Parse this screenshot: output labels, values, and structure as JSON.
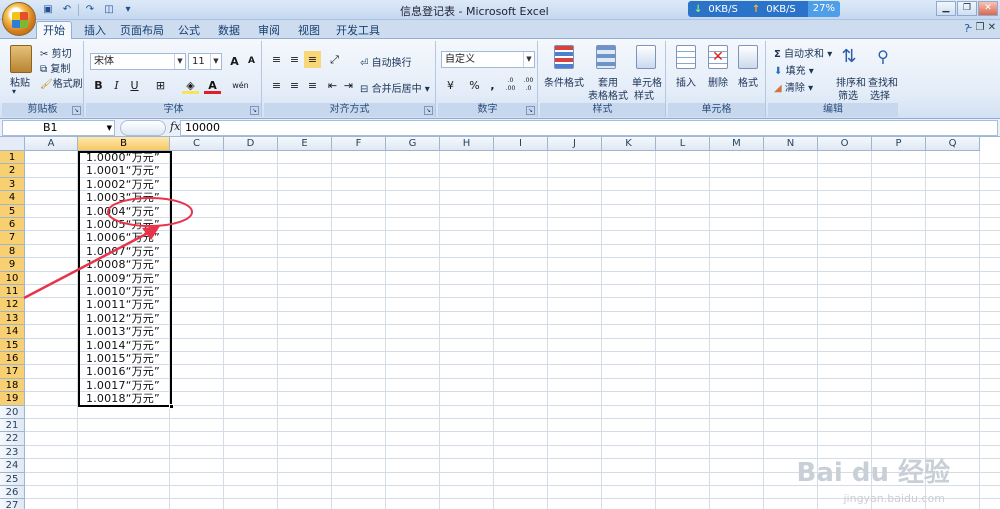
{
  "window": {
    "title": "信息登记表 - Microsoft Excel",
    "net_down": "0KB/S",
    "net_up": "0KB/S",
    "net_pct": "27%"
  },
  "tabs": [
    {
      "label": "开始",
      "active": true
    },
    {
      "label": "插入"
    },
    {
      "label": "页面布局"
    },
    {
      "label": "公式"
    },
    {
      "label": "数据"
    },
    {
      "label": "审阅"
    },
    {
      "label": "视图"
    },
    {
      "label": "开发工具"
    }
  ],
  "ribbon": {
    "clipboard": {
      "paste": "粘贴",
      "cut": "剪切",
      "copy": "复制",
      "format_painter": "格式刷",
      "label": "剪贴板"
    },
    "font": {
      "name": "宋体",
      "size": "11",
      "bold": "B",
      "italic": "I",
      "underline": "U",
      "label": "字体",
      "grow": "A",
      "shrink": "A",
      "wen": "wén"
    },
    "alignment": {
      "wrap": "自动换行",
      "merge": "合并后居中",
      "label": "对齐方式"
    },
    "number": {
      "format": "自定义",
      "percent": "%",
      "comma": ",",
      "inc": ".0 .00",
      "dec": ".00 .0",
      "label": "数字"
    },
    "styles": {
      "conditional": "条件格式",
      "table1": "套用",
      "table2": "表格格式",
      "cell1": "单元格",
      "cell2": "样式",
      "label": "样式"
    },
    "cells": {
      "insert": "插入",
      "delete": "删除",
      "format": "格式",
      "label": "单元格"
    },
    "editing": {
      "autosum": "自动求和",
      "fill": "填充",
      "clear": "清除",
      "sort1": "排序和",
      "sort2": "筛选",
      "find1": "查找和",
      "find2": "选择",
      "label": "编辑"
    }
  },
  "formula_bar": {
    "name_box": "B1",
    "fx": "fx",
    "content": "10000"
  },
  "columns": [
    "A",
    "B",
    "C",
    "D",
    "E",
    "F",
    "G",
    "H",
    "I",
    "J",
    "K",
    "L",
    "M",
    "N",
    "O",
    "P",
    "Q"
  ],
  "rows": [
    "1",
    "2",
    "3",
    "4",
    "5",
    "6",
    "7",
    "8",
    "9",
    "10",
    "11",
    "12",
    "13",
    "14",
    "15",
    "16",
    "17",
    "18",
    "19",
    "20",
    "21",
    "22",
    "23",
    "24",
    "25",
    "26",
    "27"
  ],
  "cells_b": [
    "1.0000“万元”",
    "1.0001“万元”",
    "1.0002“万元”",
    "1.0003“万元”",
    "1.0004“万元”",
    "1.0005“万元”",
    "1.0006“万元”",
    "1.0007“万元”",
    "1.0008“万元”",
    "1.0009“万元”",
    "1.0010“万元”",
    "1.0011“万元”",
    "1.0012“万元”",
    "1.0013“万元”",
    "1.0014“万元”",
    "1.0015“万元”",
    "1.0016“万元”",
    "1.0017“万元”",
    "1.0018“万元”"
  ],
  "watermark": {
    "main": "Bai du 经验",
    "sub": "jingyan.baidu.com"
  },
  "colors": {
    "accent": "#2a73c9",
    "selection": "#000000",
    "annotation": "#e8344a"
  }
}
